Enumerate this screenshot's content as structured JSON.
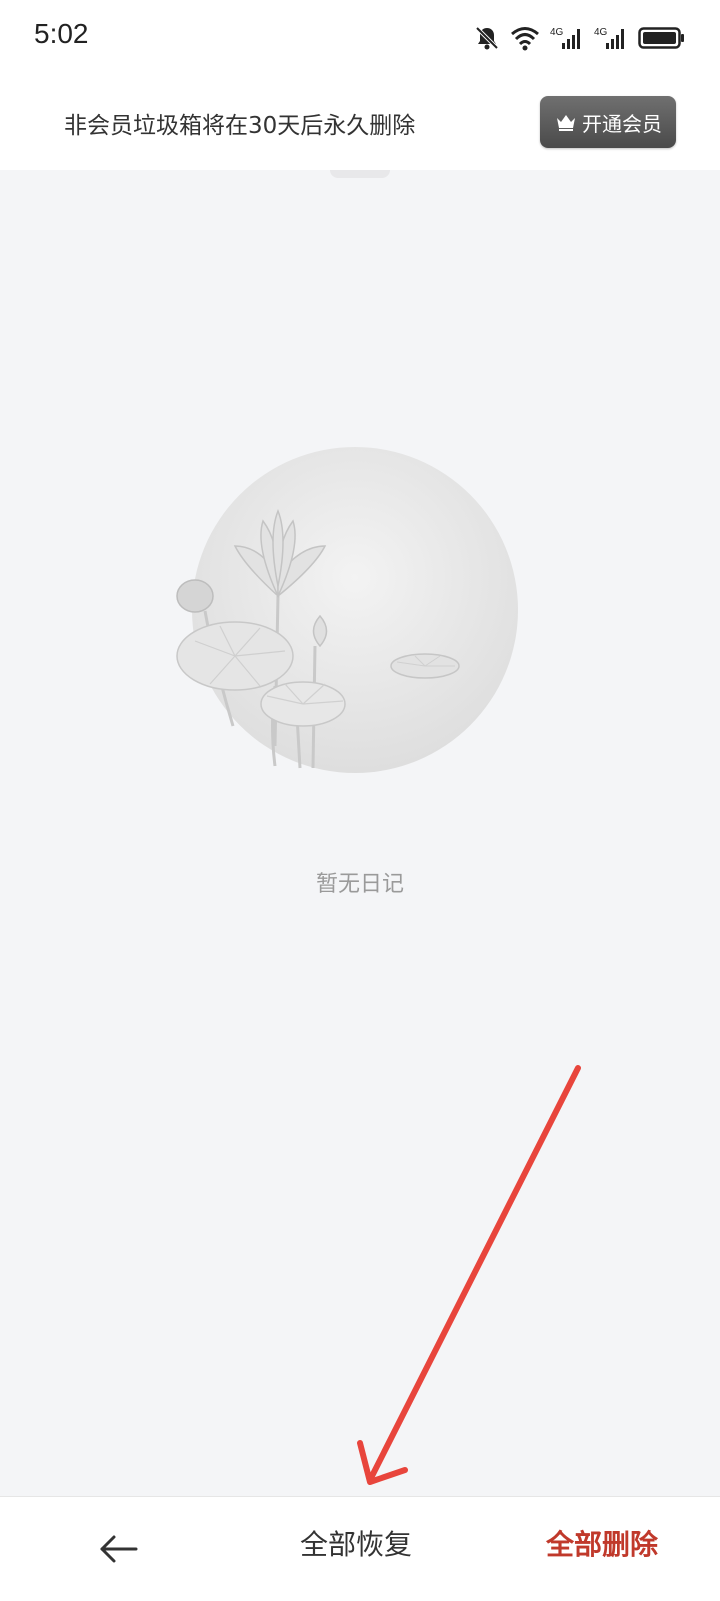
{
  "status_bar": {
    "time": "5:02",
    "icons": [
      "bell-off-icon",
      "wifi-icon",
      "signal-4g-icon",
      "signal-4g-icon",
      "battery-icon"
    ],
    "network_label_1": "4G",
    "network_label_2": "4G"
  },
  "notice": {
    "text": "非会员垃圾箱将在30天后永久删除",
    "vip_button_label": "开通会员"
  },
  "empty_state": {
    "illustration": "lotus-illustration",
    "text": "暂无日记"
  },
  "bottom_bar": {
    "back_icon": "arrow-left-icon",
    "restore_all_label": "全部恢复",
    "delete_all_label": "全部删除"
  },
  "colors": {
    "background": "#f4f5f7",
    "delete_accent": "#c0392b",
    "annotation_arrow": "#e8453c"
  }
}
